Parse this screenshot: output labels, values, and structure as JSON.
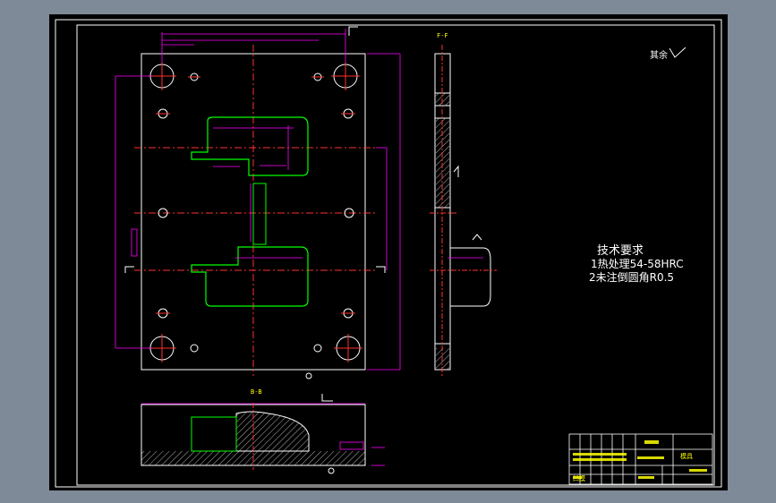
{
  "drawing": {
    "section_label_top": "F-F",
    "section_label_bottom": "B-B",
    "rest_finish_note": "其余",
    "tech_requirements": {
      "title": "技术要求",
      "lines": [
        "1热处理54-58HRC",
        "2未注倒圆角R0.5"
      ]
    },
    "colors": {
      "sheet_bg": "#000000",
      "window_bg": "#7f8a98",
      "outline": "#ffffff",
      "dimension": "#ff00ff",
      "centerline": "#ff3030",
      "cavity": "#00ff00",
      "annotation": "#ffff00",
      "title_block": "#00aaff"
    },
    "title_block": {
      "cells": [
        "模具",
        "凹模"
      ]
    }
  }
}
